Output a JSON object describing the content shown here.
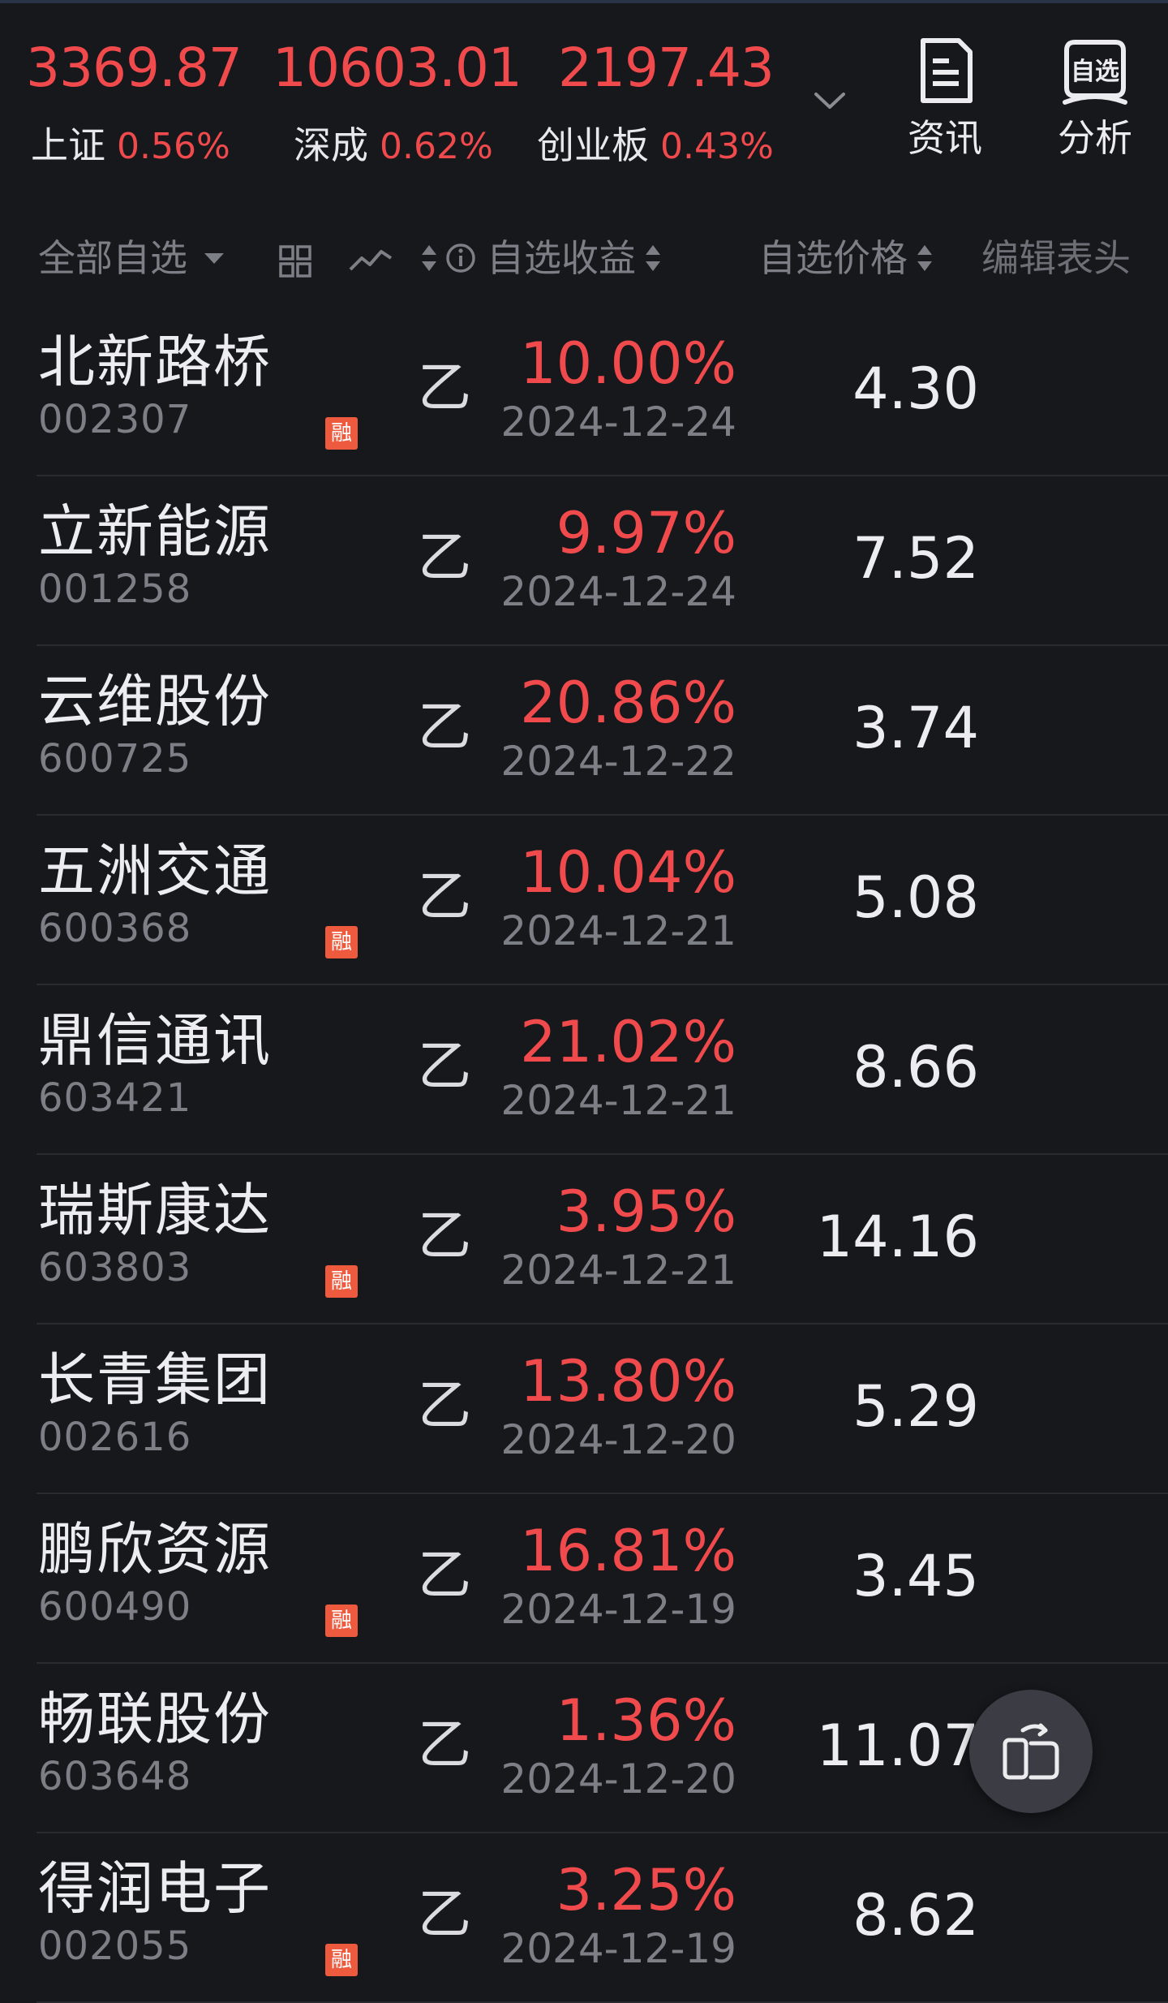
{
  "indices": [
    {
      "value": "3369.87",
      "name": "上证",
      "change": "0.56%"
    },
    {
      "value": "10603.01",
      "name": "深成",
      "change": "0.62%"
    },
    {
      "value": "2197.43",
      "name": "创业板",
      "change": "0.43%"
    }
  ],
  "header_buttons": {
    "news_label": "资讯",
    "analysis_label": "分析",
    "analysis_icon_text": "自选"
  },
  "columns": {
    "group_label": "全部自选",
    "return_label": "自选收益",
    "price_label": "自选价格",
    "edit_label": "编辑表头"
  },
  "stocks": [
    {
      "name": "北新路桥",
      "code": "002307",
      "rong": true,
      "mark": "乙",
      "return": "10.00%",
      "date": "2024-12-24",
      "price": "4.30"
    },
    {
      "name": "立新能源",
      "code": "001258",
      "rong": false,
      "mark": "乙",
      "return": "9.97%",
      "date": "2024-12-24",
      "price": "7.52"
    },
    {
      "name": "云维股份",
      "code": "600725",
      "rong": false,
      "mark": "乙",
      "return": "20.86%",
      "date": "2024-12-22",
      "price": "3.74"
    },
    {
      "name": "五洲交通",
      "code": "600368",
      "rong": true,
      "mark": "乙",
      "return": "10.04%",
      "date": "2024-12-21",
      "price": "5.08"
    },
    {
      "name": "鼎信通讯",
      "code": "603421",
      "rong": false,
      "mark": "乙",
      "return": "21.02%",
      "date": "2024-12-21",
      "price": "8.66"
    },
    {
      "name": "瑞斯康达",
      "code": "603803",
      "rong": true,
      "mark": "乙",
      "return": "3.95%",
      "date": "2024-12-21",
      "price": "14.16"
    },
    {
      "name": "长青集团",
      "code": "002616",
      "rong": false,
      "mark": "乙",
      "return": "13.80%",
      "date": "2024-12-20",
      "price": "5.29"
    },
    {
      "name": "鹏欣资源",
      "code": "600490",
      "rong": true,
      "mark": "乙",
      "return": "16.81%",
      "date": "2024-12-19",
      "price": "3.45"
    },
    {
      "name": "畅联股份",
      "code": "603648",
      "rong": false,
      "mark": "乙",
      "return": "1.36%",
      "date": "2024-12-20",
      "price": "11.07"
    },
    {
      "name": "得润电子",
      "code": "002055",
      "rong": true,
      "mark": "乙",
      "return": "3.25%",
      "date": "2024-12-19",
      "price": "8.62"
    }
  ],
  "rong_label": "融",
  "colors": {
    "up_red": "#f04a4d",
    "background": "#17181c",
    "muted": "#7d7f86",
    "rong_badge": "#ee5a3e"
  }
}
